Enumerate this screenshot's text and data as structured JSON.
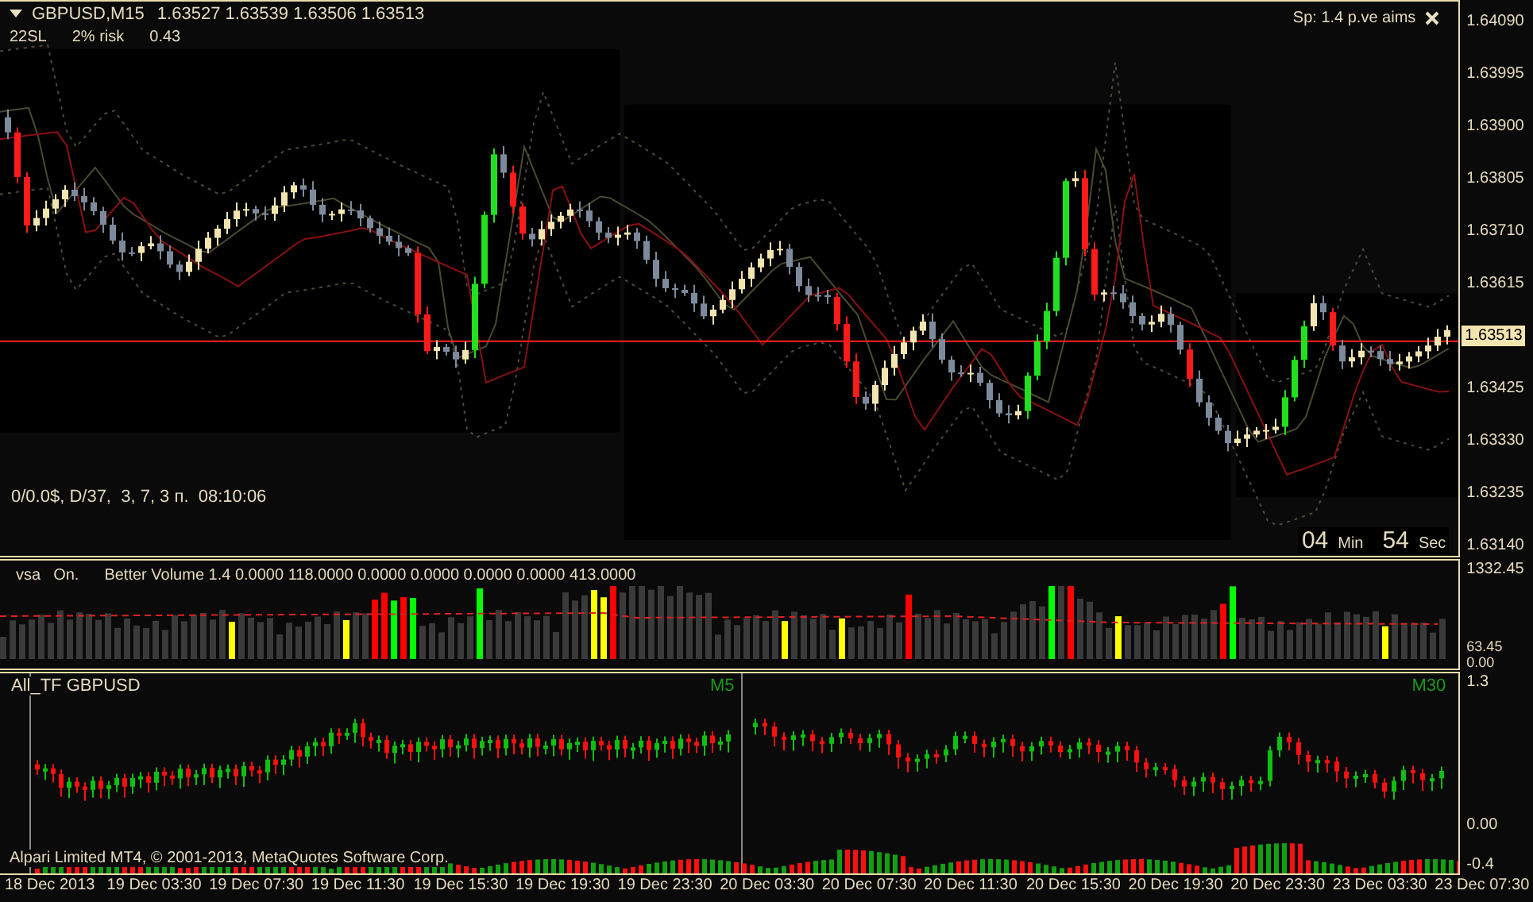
{
  "chart": {
    "symbol": "GBPUSD,M15",
    "ohlc": "1.63527 1.63539 1.63506 1.63513",
    "info": [
      "22SL",
      "2% risk",
      "0.43"
    ],
    "spread": "Sp: 1.4 p.ve aims",
    "account_status": "0/0.0$, D/37,  3, 7, 3 п.  08:10:06",
    "timer": [
      {
        "value": "04",
        "unit": "Min"
      },
      {
        "value": "54",
        "unit": "Sec"
      }
    ],
    "price_axis": [
      "1.64090",
      "1.63995",
      "1.63900",
      "1.63805",
      "1.63710",
      "1.63615",
      "1.63425",
      "1.63330",
      "1.63235",
      "1.63140"
    ],
    "current_price": "1.63513"
  },
  "volume_panel": {
    "labels": [
      "vsa",
      "On."
    ],
    "legend": "Better Volume 1.4 0.0000 118.0000 0.0000 0.0000 0.0000 0.0000 413.0000",
    "axis": [
      "1332.45",
      "63.45",
      "0.00"
    ]
  },
  "all_tf_panel": {
    "title": "All_TF GBPUSD",
    "timeframes": [
      "M5",
      "M30"
    ],
    "copyright": "Alpari Limited MT4, © 2001-2013, MetaQuotes Software Corp.",
    "axis": [
      "1.3",
      "0.00",
      "-0.4"
    ]
  },
  "time_axis": [
    "18 Dec 2013",
    "19 Dec 03:30",
    "19 Dec 07:30",
    "19 Dec 11:30",
    "19 Dec 15:30",
    "19 Dec 19:30",
    "19 Dec 23:30",
    "20 Dec 03:30",
    "20 Dec 07:30",
    "20 Dec 11:30",
    "20 Dec 15:30",
    "20 Dec 19:30",
    "20 Dec 23:30",
    "23 Dec 03:30",
    "23 Dec 07:30"
  ]
}
